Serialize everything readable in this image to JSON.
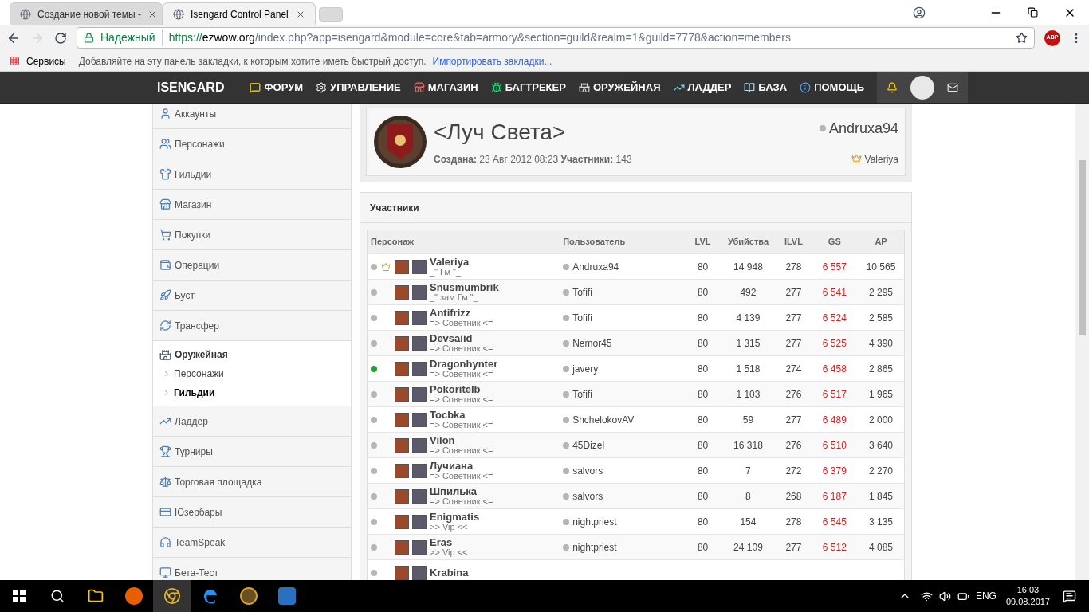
{
  "browser": {
    "tabs": [
      {
        "label": "Создание новой темы -",
        "selected": false
      },
      {
        "label": "Isengard Control Panel",
        "selected": true
      }
    ],
    "security_label": "Надежный",
    "url": {
      "scheme": "https://",
      "host": "ezwow.org",
      "path": "/index.php?app=isengard&module=core&tab=armory&section=guild&realm=1&guild=7778&action=members"
    },
    "bookmarks": {
      "apps": "Сервисы",
      "hint": "Добавляйте на эту панель закладки, к которым хотите иметь быстрый доступ.",
      "import_link": "Импортировать закладки..."
    },
    "extension_badge": "ABP"
  },
  "navbar": {
    "logo": "ISENGARD",
    "items": [
      "ФОРУМ",
      "УПРАВЛЕНИЕ",
      "МАГАЗИН",
      "БАГТРЕКЕР",
      "ОРУЖЕЙНАЯ",
      "ЛАДДЕР",
      "БАЗА",
      "ПОМОЩЬ"
    ]
  },
  "sidebar": {
    "items": [
      {
        "label": "Аккаунты",
        "expanded": false
      },
      {
        "label": "Персонажи",
        "expanded": false
      },
      {
        "label": "Гильдии",
        "expanded": false
      },
      {
        "label": "Магазин",
        "expanded": false
      },
      {
        "label": "Покупки",
        "expanded": false
      },
      {
        "label": "Операции",
        "expanded": false
      },
      {
        "label": "Буст",
        "expanded": false
      },
      {
        "label": "Трансфер",
        "expanded": false
      },
      {
        "label": "Оружейная",
        "expanded": true,
        "children": [
          {
            "label": "Персонажи",
            "selected": false
          },
          {
            "label": "Гильдии",
            "selected": true
          }
        ]
      },
      {
        "label": "Ладдер",
        "expanded": false
      },
      {
        "label": "Турниры",
        "expanded": false
      },
      {
        "label": "Торговая площадка",
        "expanded": false
      },
      {
        "label": "Юзербары",
        "expanded": false
      },
      {
        "label": "TeamSpeak",
        "expanded": false
      },
      {
        "label": "Бета-Тест",
        "expanded": false
      }
    ]
  },
  "guild": {
    "name": "<Луч Света>",
    "created_label": "Создана:",
    "created": "23 Авг 2012 08:23",
    "members_label": "Участники:",
    "members": "143",
    "owner": "Andruxa94",
    "leader": "Valeriya"
  },
  "members": {
    "title": "Участники",
    "table": {
      "columns": [
        "Персонаж",
        "Пользователь",
        "LVL",
        "Убийства",
        "ILVL",
        "GS",
        "AP"
      ],
      "rows": [
        {
          "online": false,
          "leader": true,
          "name": "Valeriya",
          "rank": "_\" Гм \"_",
          "user": "Andruxa94",
          "lvl": "80",
          "kills": "14 948",
          "ilvl": "278",
          "gs": "6 557",
          "ap": "10 565"
        },
        {
          "online": false,
          "leader": false,
          "name": "Snusmumbrik",
          "rank": "_\" зам Гм \"_",
          "user": "Tofifi",
          "lvl": "80",
          "kills": "492",
          "ilvl": "277",
          "gs": "6 541",
          "ap": "2 295"
        },
        {
          "online": false,
          "leader": false,
          "name": "Antifrizz",
          "rank": "=> Советник <=",
          "user": "Tofifi",
          "lvl": "80",
          "kills": "4 139",
          "ilvl": "277",
          "gs": "6 524",
          "ap": "2 585"
        },
        {
          "online": false,
          "leader": false,
          "name": "Devsaiid",
          "rank": "=> Советник <=",
          "user": "Nemor45",
          "lvl": "80",
          "kills": "1 315",
          "ilvl": "277",
          "gs": "6 525",
          "ap": "4 390"
        },
        {
          "online": true,
          "leader": false,
          "name": "Dragonhynter",
          "rank": "=> Советник <=",
          "user": "javery",
          "lvl": "80",
          "kills": "1 518",
          "ilvl": "274",
          "gs": "6 458",
          "ap": "2 865"
        },
        {
          "online": false,
          "leader": false,
          "name": "Pokoritelb",
          "rank": "=> Советник <=",
          "user": "Tofifi",
          "lvl": "80",
          "kills": "1 103",
          "ilvl": "276",
          "gs": "6 517",
          "ap": "1 965"
        },
        {
          "online": false,
          "leader": false,
          "name": "Tocbka",
          "rank": "=> Советник <=",
          "user": "ShchelokovAV",
          "lvl": "80",
          "kills": "59",
          "ilvl": "277",
          "gs": "6 489",
          "ap": "2 000"
        },
        {
          "online": false,
          "leader": false,
          "name": "Vilon",
          "rank": "=> Советник <=",
          "user": "45Dizel",
          "lvl": "80",
          "kills": "16 318",
          "ilvl": "276",
          "gs": "6 510",
          "ap": "3 640"
        },
        {
          "online": false,
          "leader": false,
          "name": "Лучиана",
          "rank": "=> Советник <=",
          "user": "salvors",
          "lvl": "80",
          "kills": "7",
          "ilvl": "272",
          "gs": "6 379",
          "ap": "2 270"
        },
        {
          "online": false,
          "leader": false,
          "name": "Шпилька",
          "rank": "=> Советник <=",
          "user": "salvors",
          "lvl": "80",
          "kills": "8",
          "ilvl": "268",
          "gs": "6 187",
          "ap": "1 845"
        },
        {
          "online": false,
          "leader": false,
          "name": "Enigmatis",
          "rank": ">> Vip <<",
          "user": "nightpriest",
          "lvl": "80",
          "kills": "154",
          "ilvl": "278",
          "gs": "6 545",
          "ap": "3 135"
        },
        {
          "online": false,
          "leader": false,
          "name": "Eras",
          "rank": ">> Vip <<",
          "user": "nightpriest",
          "lvl": "80",
          "kills": "24 109",
          "ilvl": "277",
          "gs": "6 512",
          "ap": "4 085"
        },
        {
          "online": false,
          "leader": false,
          "name": "Krabina"
        }
      ]
    }
  },
  "taskbar": {
    "language": "ENG",
    "time": "16:03",
    "date": "09.08.2017"
  }
}
